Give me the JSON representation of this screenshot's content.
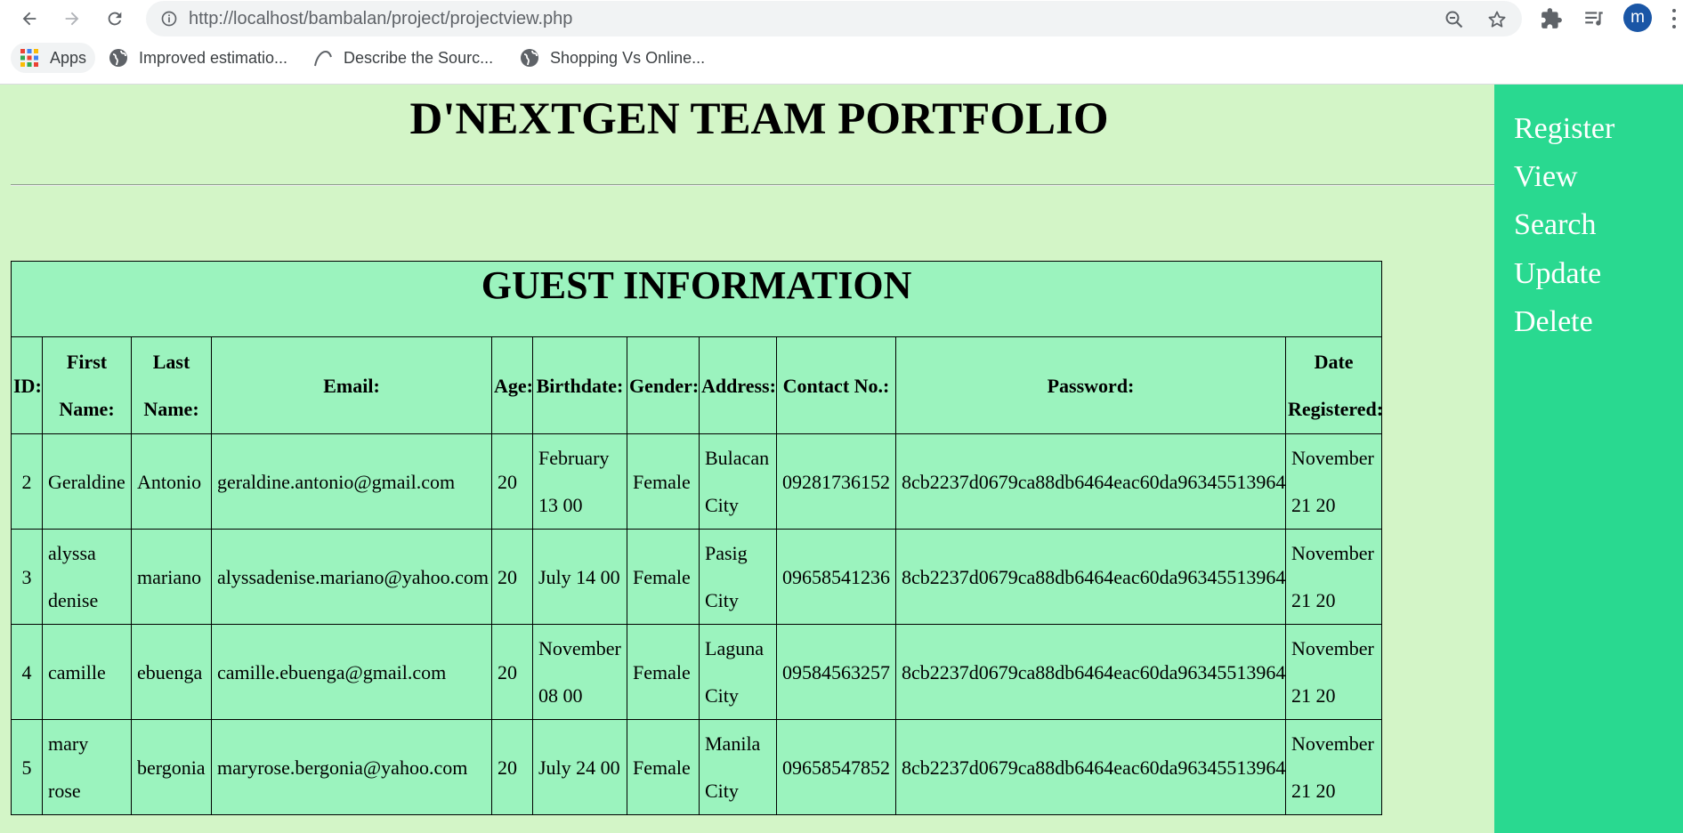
{
  "browser": {
    "url_host": "http://localhost",
    "url_path": "/bambalan/project/projectview.php",
    "profile_initial": "m",
    "bookmarks": [
      {
        "label": "Apps",
        "icon": "apps-grid-icon"
      },
      {
        "label": "Improved estimatio...",
        "icon": "globe-icon"
      },
      {
        "label": "Describe the Sourc...",
        "icon": "arc-icon"
      },
      {
        "label": "Shopping Vs Online...",
        "icon": "globe-icon"
      }
    ]
  },
  "page": {
    "title": "D'NEXTGEN TEAM PORTFOLIO"
  },
  "sidebar": {
    "links": [
      "Register",
      "View",
      "Search",
      "Update",
      "Delete"
    ]
  },
  "table": {
    "caption": "GUEST INFORMATION",
    "headers": [
      "ID:",
      "First Name:",
      "Last Name:",
      "Email:",
      "Age:",
      "Birthdate:",
      "Gender:",
      "Address:",
      "Contact No.:",
      "Password:",
      "Date Registered:"
    ],
    "rows": [
      [
        "2",
        "Geraldine",
        "Antonio",
        "geraldine.antonio@gmail.com",
        "20",
        "February 13 00",
        "Female",
        "Bulacan City",
        "09281736152",
        "8cb2237d0679ca88db6464eac60da96345513964",
        "November 21 20"
      ],
      [
        "3",
        "alyssa denise",
        "mariano",
        "alyssadenise.mariano@yahoo.com",
        "20",
        "July 14 00",
        "Female",
        "Pasig City",
        "09658541236",
        "8cb2237d0679ca88db6464eac60da96345513964",
        "November 21 20"
      ],
      [
        "4",
        "camille",
        "ebuenga",
        "camille.ebuenga@gmail.com",
        "20",
        "November 08 00",
        "Female",
        "Laguna City",
        "09584563257",
        "8cb2237d0679ca88db6464eac60da96345513964",
        "November 21 20"
      ],
      [
        "5",
        "mary rose",
        "bergonia",
        "maryrose.bergonia@yahoo.com",
        "20",
        "July 24 00",
        "Female",
        "Manila City",
        "09658547852",
        "8cb2237d0679ca88db6464eac60da96345513964",
        "November 21 20"
      ]
    ]
  }
}
